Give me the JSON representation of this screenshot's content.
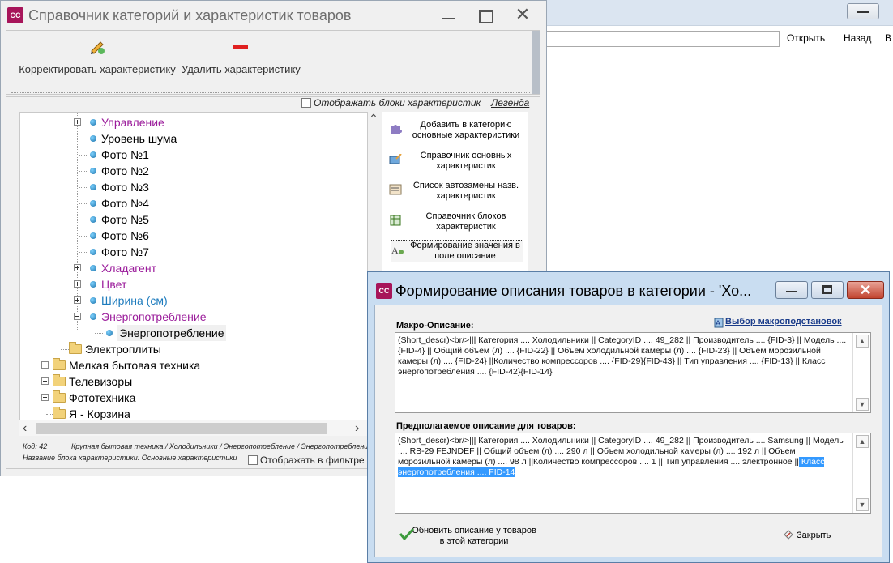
{
  "bg_window": {
    "links": [
      "Открыть",
      "Назад",
      "В"
    ]
  },
  "main_window": {
    "app_icon": "CC",
    "title": "Справочник категорий и характеристик товаров",
    "toolbar": {
      "edit_label": "Корректировать характеристику",
      "delete_label": "Удалить характеристику"
    },
    "show_blocks_label": "Отображать блоки характеристик",
    "legend_label": "Легенда",
    "tree": [
      {
        "label": "Управление",
        "color": "#9b1c9b",
        "expand": true,
        "kind": "bullet"
      },
      {
        "label": "Уровень шума",
        "color": "#000000",
        "expand": false,
        "kind": "bullet"
      },
      {
        "label": "Фото №1",
        "color": "#000000",
        "expand": false,
        "kind": "bullet"
      },
      {
        "label": "Фото №2",
        "color": "#000000",
        "expand": false,
        "kind": "bullet"
      },
      {
        "label": "Фото №3",
        "color": "#000000",
        "expand": false,
        "kind": "bullet"
      },
      {
        "label": "Фото №4",
        "color": "#000000",
        "expand": false,
        "kind": "bullet"
      },
      {
        "label": "Фото №5",
        "color": "#000000",
        "expand": false,
        "kind": "bullet"
      },
      {
        "label": "Фото №6",
        "color": "#000000",
        "expand": false,
        "kind": "bullet"
      },
      {
        "label": "Фото №7",
        "color": "#000000",
        "expand": false,
        "kind": "bullet"
      },
      {
        "label": "Хладагент",
        "color": "#9b1c9b",
        "expand": true,
        "kind": "bullet"
      },
      {
        "label": "Цвет",
        "color": "#9b1c9b",
        "expand": true,
        "kind": "bullet"
      },
      {
        "label": "Ширина (см)",
        "color": "#1d7bbd",
        "expand": true,
        "kind": "bullet"
      },
      {
        "label": "Энергопотребление",
        "color": "#9b1c9b",
        "expand": "minus",
        "kind": "bullet"
      },
      {
        "label": "Энергопотребление",
        "color": "#000000",
        "expand": false,
        "kind": "child"
      },
      {
        "label": "Электроплиты",
        "color": "#000000",
        "expand": false,
        "kind": "folder1"
      },
      {
        "label": "Мелкая бытовая техника",
        "color": "#000000",
        "expand": true,
        "kind": "folder0"
      },
      {
        "label": "Телевизоры",
        "color": "#000000",
        "expand": true,
        "kind": "folder0"
      },
      {
        "label": "Фототехника",
        "color": "#000000",
        "expand": true,
        "kind": "folder0"
      },
      {
        "label": "Я - Корзина",
        "color": "#000000",
        "expand": false,
        "kind": "folder0"
      }
    ],
    "status": {
      "code": "Код: 42",
      "path": "Крупная бытовая техника / Холодильники / Энергопотребление / Энергопотребление",
      "block": "Название блока характеристики: Основные характеристики",
      "show_in_filter": "Отображать в фильтре"
    },
    "side_actions": [
      "Добавить в категорию основные характеристики",
      "Справочник основных характеристик",
      "Список автозамены назв. характеристик",
      "Справочник блоков характеристик",
      "Формирование значения в поле описание"
    ]
  },
  "dialog": {
    "app_icon": "CC",
    "title": "Формирование описания товаров в категории - 'Хо...",
    "macro_label": "Макро-Описание:",
    "macro_link": "Выбор макроподстановок",
    "macro_text": "(Short_descr)<br/>||| Категория .... Холодильники || CategoryID .... 49_282 || Производитель ....  {FID-3} || Модель ....  {FID-4} || Общий объем (л) ....  {FID-22} || Объем холодильной камеры (л) .... {FID-23} || Объем морозильной камеры (л) .... {FID-24} ||Количество компрессоров .... {FID-29}{FID-43} || Тип управления .... {FID-13} || Класс энергопотребления .... {FID-42}{FID-14}",
    "preview_label": "Предполагаемое описание для товаров:",
    "preview_text": "(Short_descr)<br/>||| Категория .... Холодильники || CategoryID .... 49_282 || Производитель ....  Samsung || Модель ....  RB-29 FEJNDEF || Общий объем (л) ....  290 л || Объем холодильной камеры (л) .... 192 л || Объем морозильной камеры (л) .... 98 л ||Количество компрессоров .... 1  || Тип управления .... электронное ||",
    "preview_selected": " Класс энергопотребления ....  FID-14",
    "update_label": "Обновить описание у товаров в этой категории",
    "close_label": "Закрыть"
  }
}
